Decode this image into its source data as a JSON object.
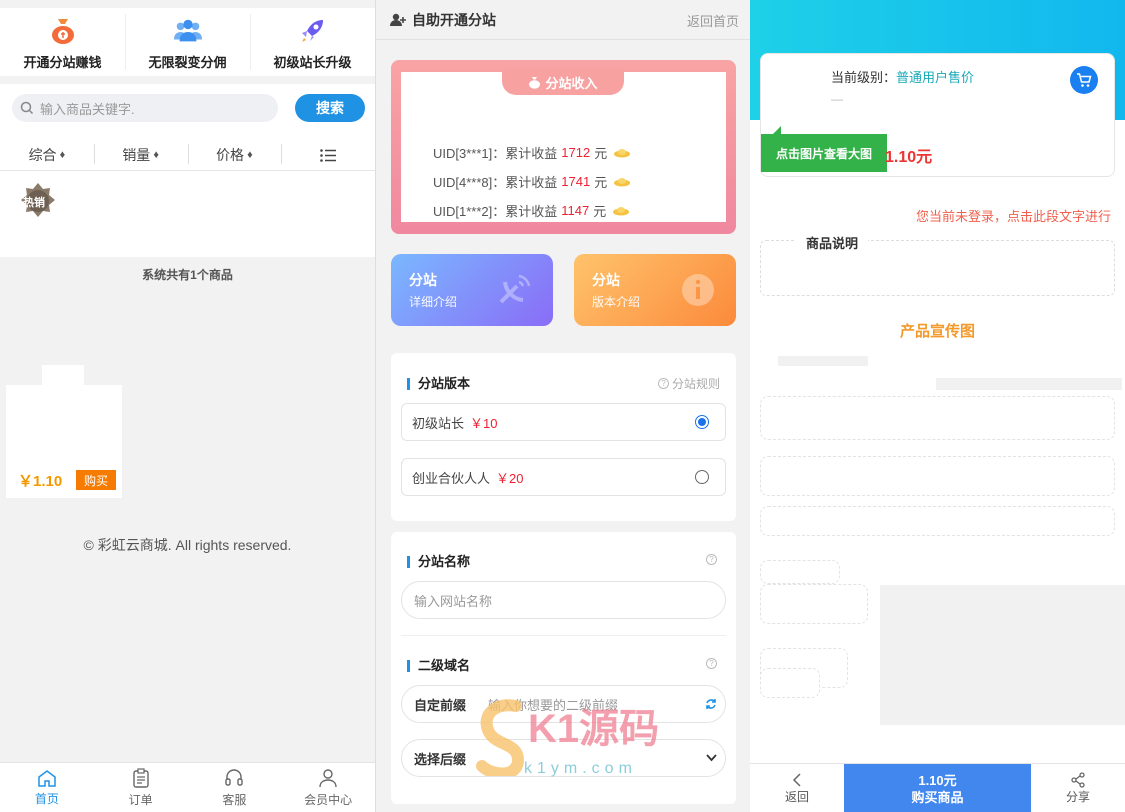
{
  "left": {
    "categories": [
      {
        "label": "开通分站赚钱",
        "icon": "money-bag-icon"
      },
      {
        "label": "无限裂变分佣",
        "icon": "users-group-icon"
      },
      {
        "label": "初级站长升级",
        "icon": "rocket-icon"
      }
    ],
    "search": {
      "placeholder": "输入商品关键字.",
      "button": "搜索"
    },
    "sort": [
      {
        "label": "综合",
        "arrow": "♦"
      },
      {
        "label": "销量",
        "arrow": "♦"
      },
      {
        "label": "价格",
        "arrow": "♦"
      }
    ],
    "hot_badge": "热销",
    "total": "系统共有1个商品",
    "product": {
      "price": "￥1.10",
      "buy": "购买"
    },
    "copyright": "© 彩虹云商城. All rights reserved.",
    "nav": [
      {
        "label": "首页",
        "icon": "home-icon"
      },
      {
        "label": "订单",
        "icon": "clipboard-icon"
      },
      {
        "label": "客服",
        "icon": "headset-icon"
      },
      {
        "label": "会员中心",
        "icon": "user-icon"
      }
    ]
  },
  "mid": {
    "title": "自助开通分站",
    "back_home": "返回首页",
    "income_title": "分站收入",
    "income": [
      {
        "uid": "UID[3***1]：",
        "label": "累计收益",
        "amount": "1712",
        "unit": "元"
      },
      {
        "uid": "UID[4***8]：",
        "label": "累计收益",
        "amount": "1741",
        "unit": "元"
      },
      {
        "uid": "UID[1***2]：",
        "label": "累计收益",
        "amount": "1147",
        "unit": "元"
      }
    ],
    "features": [
      {
        "title": "分站",
        "sub": "详细介绍"
      },
      {
        "title": "分站",
        "sub": "版本介绍"
      }
    ],
    "version": {
      "title": "分站版本",
      "rules": "分站规则",
      "options": [
        {
          "label": "初级站长",
          "price": "￥10",
          "selected": true
        },
        {
          "label": "创业合伙人人",
          "price": "￥20",
          "selected": false
        }
      ]
    },
    "site_name": {
      "title": "分站名称",
      "placeholder": "输入网站名称"
    },
    "domain": {
      "title": "二级域名",
      "prefix_label": "自定前缀",
      "prefix_placeholder": "输入你想要的二级前缀",
      "suffix_label": "选择后缀"
    },
    "watermark": {
      "text": "K1源码",
      "url": "k1ym.com"
    }
  },
  "right": {
    "level_label": "当前级别：",
    "level_value": "普通用户售价",
    "dash": "—",
    "view_image": "点击图片查看大图",
    "price": "1.10元",
    "login_notice": "您当前未登录，点击此段文字进行",
    "desc_title": "商品说明",
    "promo_title": "产品宣传图",
    "bottom": {
      "back": "返回",
      "buy_price": "1.10元",
      "buy": "购买商品",
      "share": "分享"
    }
  }
}
